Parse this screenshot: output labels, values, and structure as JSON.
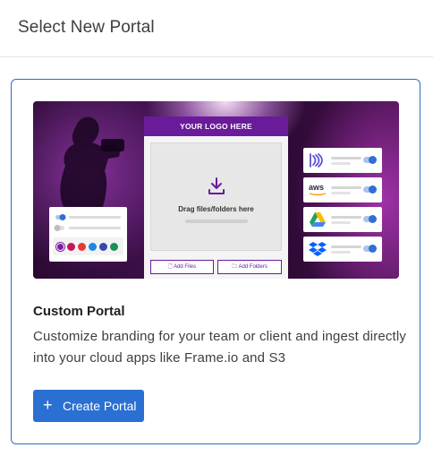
{
  "header": {
    "title": "Select New Portal"
  },
  "card": {
    "preview": {
      "logo_text": "YOUR LOGO HERE",
      "drop_text": "Drag files/folders here",
      "add_files_label": "Add Files",
      "add_folders_label": "Add Folders",
      "swatch_colors": [
        "#7b1fa2",
        "#c2185b",
        "#e53935",
        "#1e88e5",
        "#3949ab",
        "#1b8f5a"
      ],
      "apps": [
        {
          "icon": "frameio-icon"
        },
        {
          "icon": "aws-icon",
          "text": "aws"
        },
        {
          "icon": "google-drive-icon"
        },
        {
          "icon": "dropbox-icon"
        }
      ]
    },
    "name": "Custom Portal",
    "description": "Customize branding for your team or client and ingest directly into your cloud apps like Frame.io and S3",
    "button": {
      "icon": "plus-icon",
      "label": "Create Portal"
    }
  },
  "colors": {
    "accent": "#2a6fd2",
    "border": "#2d6fc4",
    "brand_purple": "#6a1b9a"
  }
}
